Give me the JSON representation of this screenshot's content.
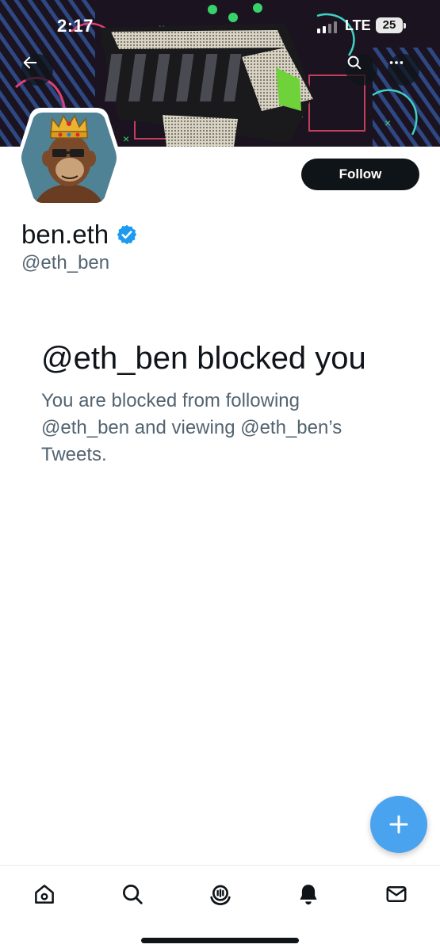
{
  "status_bar": {
    "time": "2:17",
    "network": "LTE",
    "battery": "25"
  },
  "header": {
    "back_icon": "arrow-left-icon",
    "search_icon": "search-icon",
    "more_icon": "more-horizontal-icon"
  },
  "profile": {
    "display_name": "ben.eth",
    "handle": "@eth_ben",
    "verified": true,
    "follow_label": "Follow"
  },
  "blocked": {
    "title": "@eth_ben blocked you",
    "description": "You are blocked from following @eth_ben and viewing @eth_ben’s Tweets."
  },
  "fab": {
    "icon": "plus-icon"
  },
  "bottom_nav": {
    "items": [
      {
        "icon": "home-icon"
      },
      {
        "icon": "search-icon"
      },
      {
        "icon": "spaces-icon"
      },
      {
        "icon": "notifications-icon"
      },
      {
        "icon": "messages-icon"
      }
    ]
  },
  "colors": {
    "accent": "#1d9bf0",
    "fab": "#4aa3ee",
    "text_primary": "#0f1419",
    "text_secondary": "#536471"
  }
}
